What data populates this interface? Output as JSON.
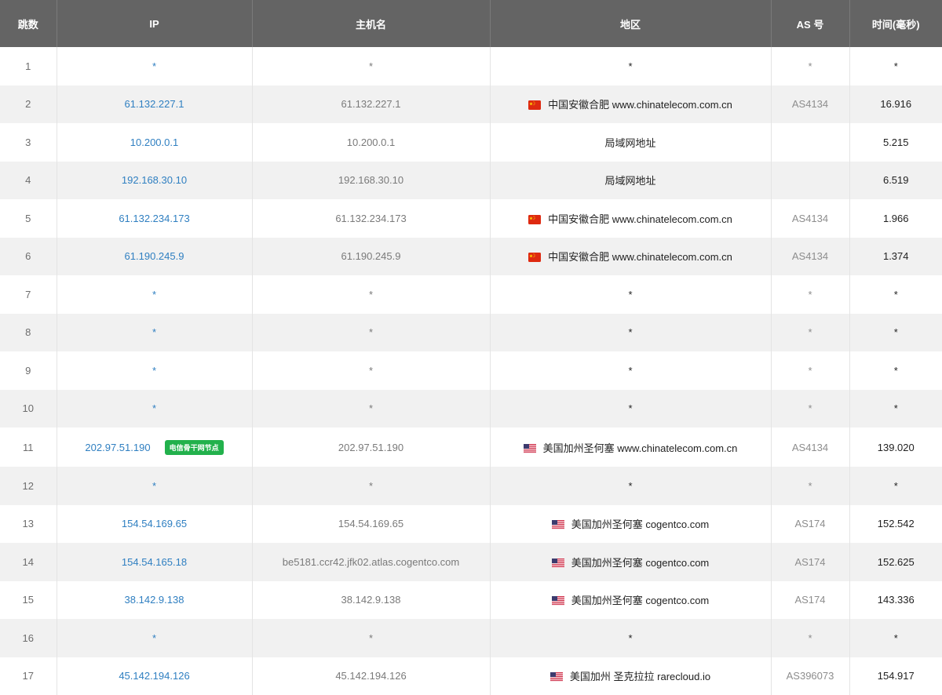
{
  "header": {
    "hop": "跳数",
    "ip": "IP",
    "hostname": "主机名",
    "region": "地区",
    "as": "AS 号",
    "time": "时间(毫秒)"
  },
  "rows": [
    {
      "hop": "1",
      "ip": "*",
      "host": "*",
      "region": "*",
      "flag": "",
      "as": "*",
      "time": "*"
    },
    {
      "hop": "2",
      "ip": "61.132.227.1",
      "host": "61.132.227.1",
      "region": "中国安徽合肥 www.chinatelecom.com.cn",
      "flag": "cn-flag-icon",
      "as": "AS4134",
      "time": "16.916"
    },
    {
      "hop": "3",
      "ip": "10.200.0.1",
      "host": "10.200.0.1",
      "region": "局域网地址",
      "flag": "",
      "as": "",
      "time": "5.215"
    },
    {
      "hop": "4",
      "ip": "192.168.30.10",
      "host": "192.168.30.10",
      "region": "局域网地址",
      "flag": "",
      "as": "",
      "time": "6.519"
    },
    {
      "hop": "5",
      "ip": "61.132.234.173",
      "host": "61.132.234.173",
      "region": "中国安徽合肥 www.chinatelecom.com.cn",
      "flag": "cn-flag-icon",
      "as": "AS4134",
      "time": "1.966"
    },
    {
      "hop": "6",
      "ip": "61.190.245.9",
      "host": "61.190.245.9",
      "region": "中国安徽合肥 www.chinatelecom.com.cn",
      "flag": "cn-flag-icon",
      "as": "AS4134",
      "time": "1.374"
    },
    {
      "hop": "7",
      "ip": "*",
      "host": "*",
      "region": "*",
      "flag": "",
      "as": "*",
      "time": "*"
    },
    {
      "hop": "8",
      "ip": "*",
      "host": "*",
      "region": "*",
      "flag": "",
      "as": "*",
      "time": "*"
    },
    {
      "hop": "9",
      "ip": "*",
      "host": "*",
      "region": "*",
      "flag": "",
      "as": "*",
      "time": "*"
    },
    {
      "hop": "10",
      "ip": "*",
      "host": "*",
      "region": "*",
      "flag": "",
      "as": "*",
      "time": "*"
    },
    {
      "hop": "11",
      "ip": "202.97.51.190",
      "badge": "电信骨干网节点",
      "host": "202.97.51.190",
      "region": "美国加州圣何塞 www.chinatelecom.com.cn",
      "flag": "us-flag-icon",
      "as": "AS4134",
      "time": "139.020"
    },
    {
      "hop": "12",
      "ip": "*",
      "host": "*",
      "region": "*",
      "flag": "",
      "as": "*",
      "time": "*"
    },
    {
      "hop": "13",
      "ip": "154.54.169.65",
      "host": "154.54.169.65",
      "region": "美国加州圣何塞 cogentco.com",
      "flag": "us-flag-icon",
      "as": "AS174",
      "time": "152.542"
    },
    {
      "hop": "14",
      "ip": "154.54.165.18",
      "host": "be5181.ccr42.jfk02.atlas.cogentco.com",
      "region": "美国加州圣何塞 cogentco.com",
      "flag": "us-flag-icon",
      "as": "AS174",
      "time": "152.625"
    },
    {
      "hop": "15",
      "ip": "38.142.9.138",
      "host": "38.142.9.138",
      "region": "美国加州圣何塞 cogentco.com",
      "flag": "us-flag-icon",
      "as": "AS174",
      "time": "143.336"
    },
    {
      "hop": "16",
      "ip": "*",
      "host": "*",
      "region": "*",
      "flag": "",
      "as": "*",
      "time": "*"
    },
    {
      "hop": "17",
      "ip": "45.142.194.126",
      "host": "45.142.194.126",
      "region": "美国加州 圣克拉拉 rarecloud.io",
      "flag": "us-flag-icon",
      "as": "AS396073",
      "time": "154.917"
    }
  ],
  "colors": {
    "header_bg": "#646464",
    "ip_link": "#2f7fc1",
    "badge_bg": "#22b14c"
  }
}
